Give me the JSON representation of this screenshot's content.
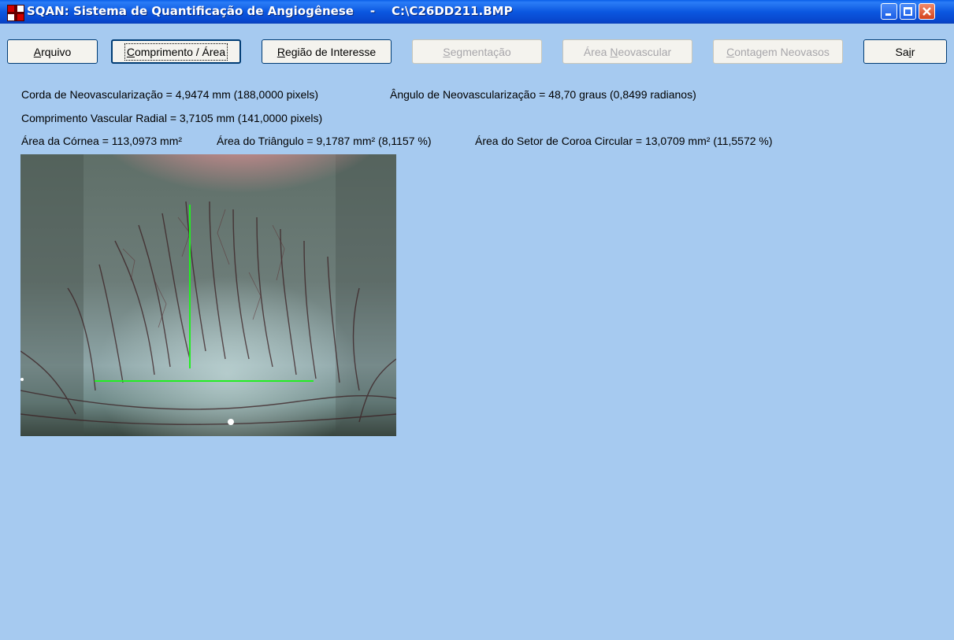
{
  "window": {
    "title": "SQAN: Sistema de Quantificação de Angiogênese    -    C:\\C26DD211.BMP"
  },
  "toolbar": {
    "buttons": [
      {
        "pre": "",
        "key": "A",
        "post": "rquivo",
        "enabled": true
      },
      {
        "pre": "",
        "key": "C",
        "post": "omprimento / Área",
        "enabled": true,
        "focused": true
      },
      {
        "pre": "",
        "key": "R",
        "post": "egião de Interesse",
        "enabled": true
      },
      {
        "pre": "",
        "key": "S",
        "post": "egmentação",
        "enabled": false
      },
      {
        "pre": "Área ",
        "key": "N",
        "post": "eovascular",
        "enabled": false
      },
      {
        "pre": "",
        "key": "C",
        "post": "ontagem Neovasos",
        "enabled": false
      },
      {
        "pre": "Sa",
        "key": "i",
        "post": "r",
        "enabled": true
      }
    ]
  },
  "measurements": {
    "chord": "Corda de Neovascularização = 4,9474 mm (188,0000 pixels)",
    "angle": "Ângulo de Neovascularização = 48,70 graus (0,8499 radianos)",
    "radial_length": "Comprimento Vascular Radial = 3,7105 mm (141,0000 pixels)",
    "cornea_area": "Área da Córnea = 113,0973 mm²",
    "triangle_area": "Área do Triângulo = 9,1787 mm² (8,1157 %)",
    "sector_area": "Área do Setor de Coroa Circular = 13,0709 mm² (11,5572 %)"
  },
  "colors": {
    "background": "#a6caf0",
    "overlay_line": "#22ee22"
  }
}
